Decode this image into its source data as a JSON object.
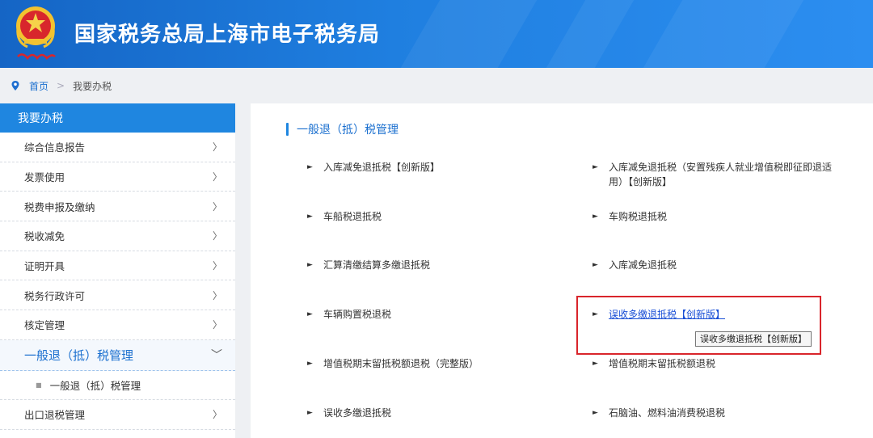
{
  "header": {
    "title": "国家税务总局上海市电子税务局",
    "emblem_icon": "tax-emblem-icon"
  },
  "breadcrumb": {
    "home": "首页",
    "separator": ">",
    "current": "我要办税"
  },
  "sidebar": {
    "title": "我要办税",
    "items": [
      {
        "label": "综合信息报告"
      },
      {
        "label": "发票使用"
      },
      {
        "label": "税费申报及缴纳"
      },
      {
        "label": "税收减免"
      },
      {
        "label": "证明开具"
      },
      {
        "label": "税务行政许可"
      },
      {
        "label": "核定管理"
      }
    ],
    "active": {
      "label": "一般退（抵）税管理",
      "sub": "一般退（抵）税管理"
    },
    "after": [
      {
        "label": "出口退税管理"
      }
    ],
    "chevron_right": "〉",
    "chevron_down": "﹀"
  },
  "main": {
    "section_title": "一般退（抵）税管理",
    "bullet": "►",
    "services": [
      {
        "label": "入库减免退抵税【创新版】"
      },
      {
        "label": "入库减免退抵税（安置残疾人就业增值税即征即退适用）【创新版】"
      },
      {
        "label": "车船税退抵税"
      },
      {
        "label": "车购税退抵税"
      },
      {
        "label": "汇算清缴结算多缴退抵税"
      },
      {
        "label": "入库减免退抵税"
      },
      {
        "label": "车辆购置税退税"
      },
      {
        "label": "误收多缴退抵税【创新版】"
      },
      {
        "label": "增值税期末留抵税额退税（完整版）"
      },
      {
        "label": "增值税期末留抵税额退税"
      },
      {
        "label": "误收多缴退抵税"
      },
      {
        "label": "石脑油、燃料油消费税退税"
      }
    ],
    "tooltip": "误收多缴退抵税【创新版】"
  },
  "colors": {
    "header_blue": "#1f7fe0",
    "accent": "#1f86e0",
    "link": "#1a4fd6",
    "highlight": "#d9252b"
  }
}
